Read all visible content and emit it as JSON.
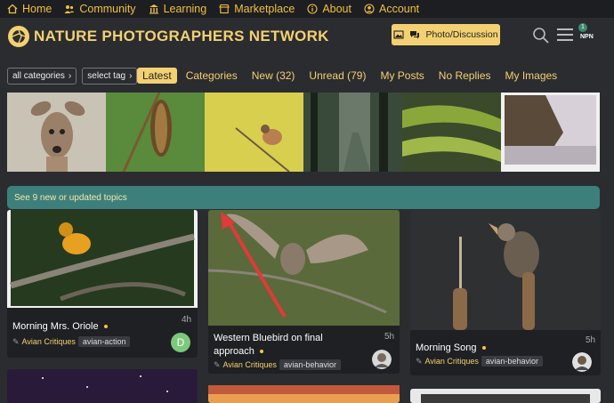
{
  "topnav": {
    "items": [
      {
        "label": "Home",
        "icon": "home-icon"
      },
      {
        "label": "Community",
        "icon": "community-icon"
      },
      {
        "label": "Learning",
        "icon": "learning-icon"
      },
      {
        "label": "Marketplace",
        "icon": "marketplace-icon"
      },
      {
        "label": "About",
        "icon": "info-icon"
      },
      {
        "label": "Account",
        "icon": "account-icon"
      }
    ]
  },
  "header": {
    "site_title": "NATURE PHOTOGRAPHERS NETWORK",
    "photo_button": "Photo/Discussion",
    "avatar_text": "NPN",
    "notification_count": "1"
  },
  "filters": {
    "category_dropdown": "all categories",
    "tag_dropdown": "select tag"
  },
  "tabs": [
    "Latest",
    "Categories",
    "New (32)",
    "Unread (79)",
    "My Posts",
    "No Replies",
    "My Images"
  ],
  "banner": {
    "text": "See 9 new or updated topics"
  },
  "cards": [
    {
      "title": "Morning Mrs. Oriole",
      "category": "Avian Critiques",
      "tag": "avian-action",
      "age": "4h",
      "avatar_letter": "D"
    },
    {
      "title": "Western Bluebird on final approach",
      "category": "Avian Critiques",
      "tag": "avian-behavior",
      "age": "5h"
    },
    {
      "title": "Morning Song",
      "category": "Avian Critiques",
      "tag": "avian-behavior",
      "age": "5h"
    }
  ],
  "colors": {
    "accent": "#f3d172",
    "banner": "#3d7f7a",
    "background": "#2b2c30",
    "topbar": "#1d1e21"
  }
}
